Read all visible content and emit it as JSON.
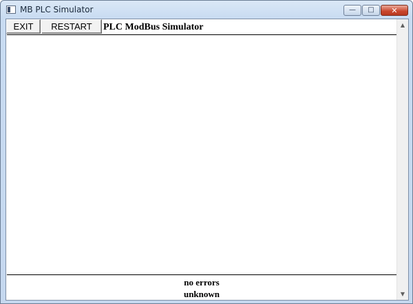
{
  "window": {
    "title": "MB PLC Simulator",
    "icon": "app-window-icon",
    "controls": {
      "minimize": "—",
      "maximize": "□",
      "close": "✕"
    }
  },
  "toolbar": {
    "exit_label": "EXIT",
    "restart_label": "RESTART"
  },
  "header": {
    "title": "PLC ModBus Simulator"
  },
  "status": {
    "line1": "no errors",
    "line2": "unknown"
  },
  "scrollbar": {
    "up_arrow": "▲",
    "down_arrow": "▼"
  }
}
